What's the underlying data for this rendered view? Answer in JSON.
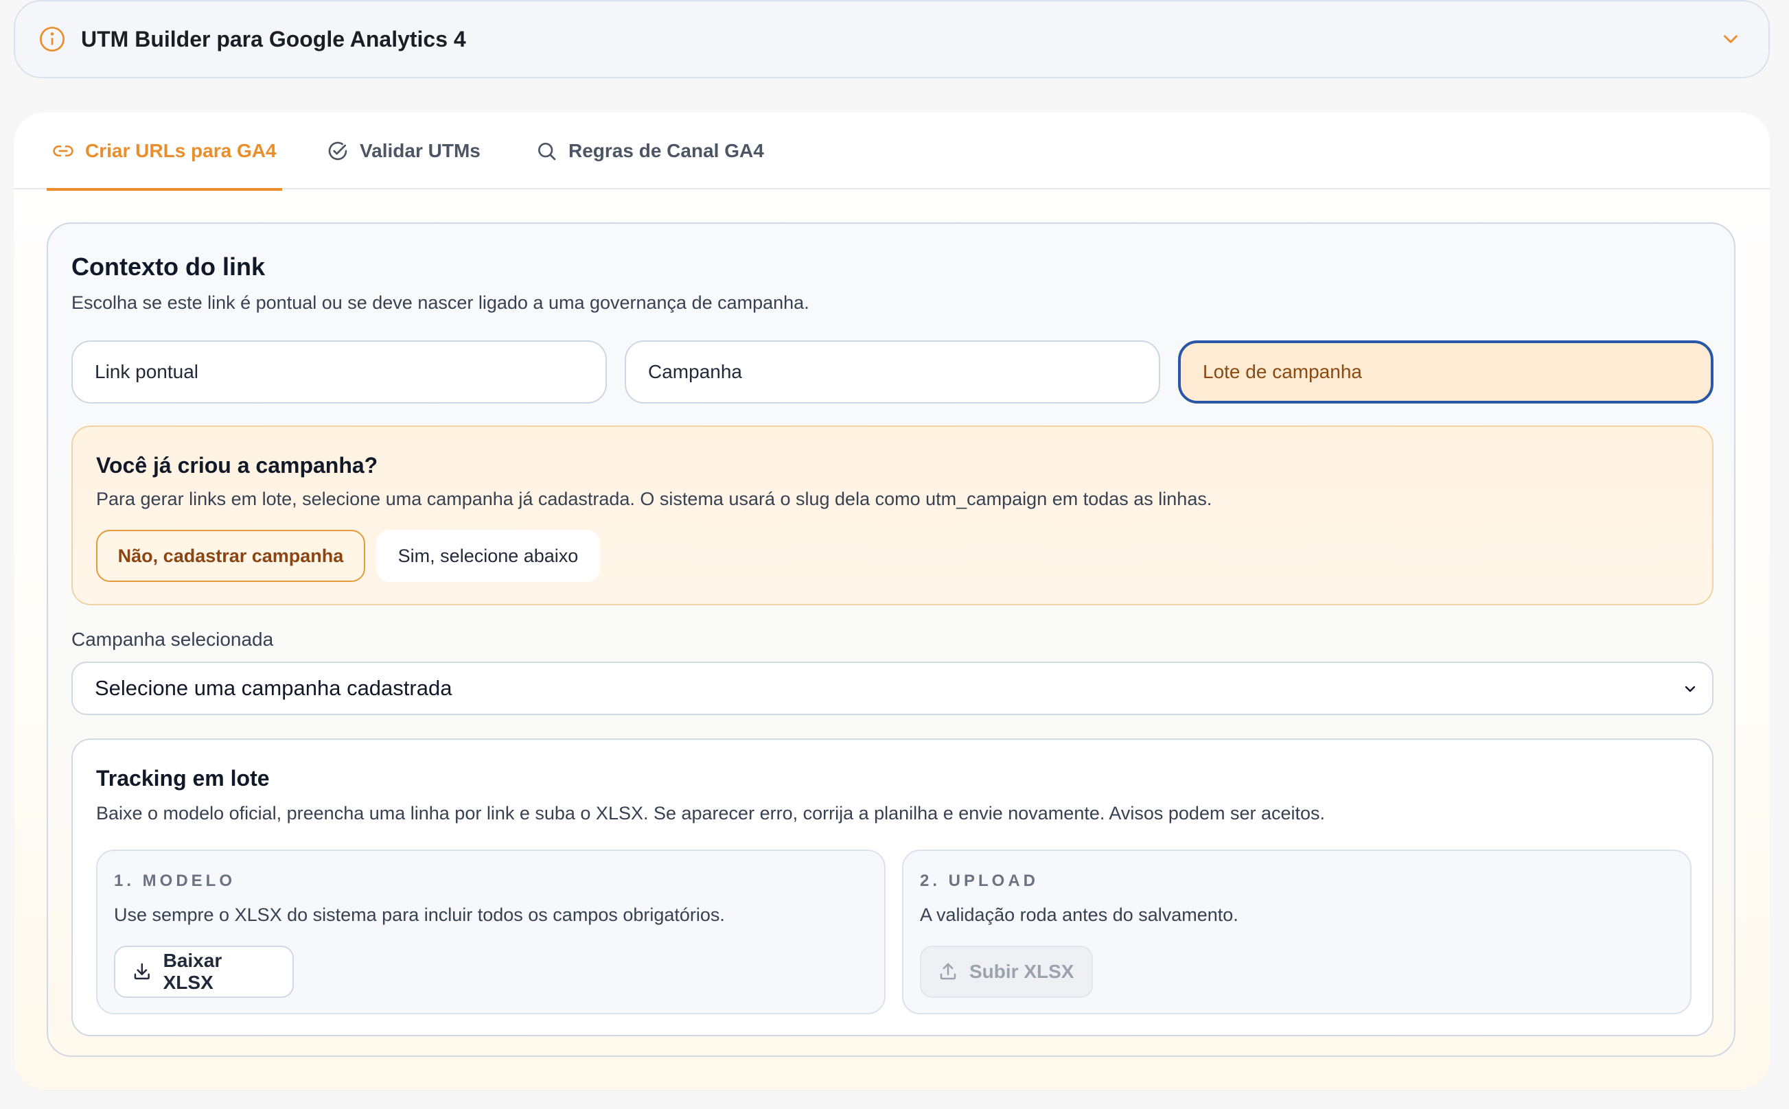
{
  "header": {
    "title": "UTM Builder para Google Analytics 4"
  },
  "tabs": [
    {
      "label": "Criar URLs para GA4",
      "icon": "link-icon",
      "active": true
    },
    {
      "label": "Validar UTMs",
      "icon": "check-circle-icon",
      "active": false
    },
    {
      "label": "Regras de Canal GA4",
      "icon": "search-icon",
      "active": false
    }
  ],
  "context": {
    "title": "Contexto do link",
    "subtitle": "Escolha se este link é pontual ou se deve nascer ligado a uma governança de campanha.",
    "options": [
      {
        "label": "Link pontual",
        "selected": false
      },
      {
        "label": "Campanha",
        "selected": false
      },
      {
        "label": "Lote de campanha",
        "selected": true
      }
    ]
  },
  "campaign_question": {
    "title": "Você já criou a campanha?",
    "text": "Para gerar links em lote, selecione uma campanha já cadastrada. O sistema usará o slug dela como utm_campaign em todas as linhas.",
    "no_label": "Não, cadastrar campanha",
    "yes_label": "Sim, selecione abaixo"
  },
  "campaign_select": {
    "label": "Campanha selecionada",
    "value": "Selecione uma campanha cadastrada"
  },
  "tracking": {
    "title": "Tracking em lote",
    "text": "Baixe o modelo oficial, preencha uma linha por link e suba o XLSX. Se aparecer erro, corrija a planilha e envie novamente. Avisos podem ser aceitos.",
    "steps": [
      {
        "label": "1. MODELO",
        "text": "Use sempre o XLSX do sistema para incluir todos os campos obrigatórios.",
        "button": "Baixar XLSX",
        "icon": "download-icon"
      },
      {
        "label": "2. UPLOAD",
        "text": "A validação roda antes do salvamento.",
        "button": "Subir XLSX",
        "icon": "upload-icon",
        "disabled": true
      }
    ]
  },
  "colors": {
    "accent": "#ea8d2b",
    "selected_border": "#2a56a8"
  }
}
